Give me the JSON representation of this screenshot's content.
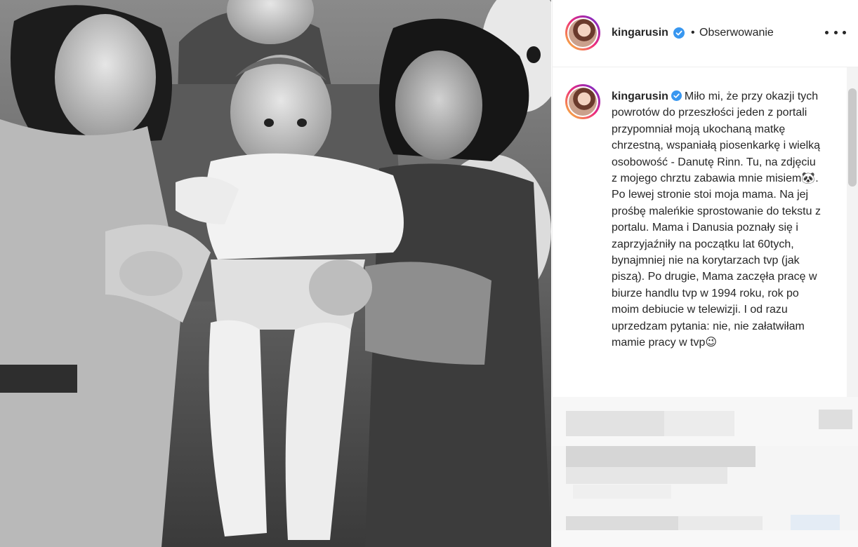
{
  "post": {
    "username": "kingarusin",
    "separator": "•",
    "follow_status": "Obserwowanie",
    "caption": "Miło mi, że przy okazji tych powrotów do przeszłości jeden z portali przypomniał moją ukochaną matkę chrzestną, wspaniałą piosenkarkę i wielką osobowość - Danutę Rinn. Tu, na zdjęciu z mojego chrztu zabawia mnie misiem🐼. Po lewej stronie stoi moja mama. Na jej prośbę maleńkie sprostowanie do tekstu z portalu. Mama i Danusia poznały się i zaprzyjaźniły na początku lat 60tych, bynajmniej nie na korytarzach tvp (jak piszą). Po drugie, Mama zaczęła pracę w biurze handlu tvp w 1994 roku, rok po moim debiucie w telewizji. I od razu uprzedzam pytania: nie, nie załatwiłam mamie pracy w tvp😉"
  },
  "icons": {
    "verified": "verified-badge-icon",
    "more": "more-options-icon",
    "avatar": "profile-avatar"
  },
  "colors": {
    "verified_blue": "#3897f0",
    "text": "#262626",
    "border": "#efefef"
  }
}
